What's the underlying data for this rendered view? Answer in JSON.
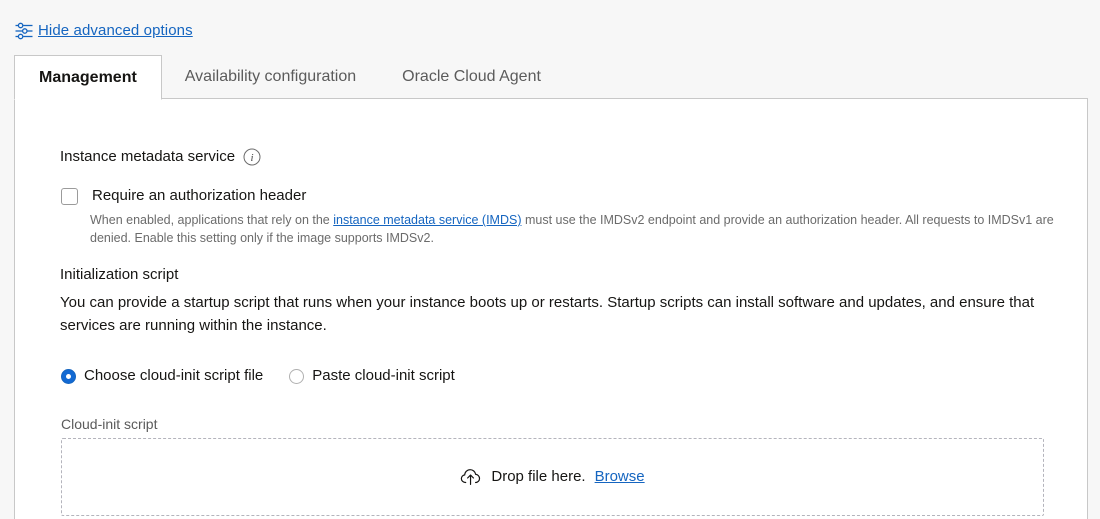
{
  "advanced": {
    "icon": "sliders-icon",
    "link_label": "Hide advanced options"
  },
  "tabs": [
    {
      "label": "Management",
      "active": true
    },
    {
      "label": "Availability configuration",
      "active": false
    },
    {
      "label": "Oracle Cloud Agent",
      "active": false
    }
  ],
  "metadata_section": {
    "heading": "Instance metadata service",
    "info_icon": "info-icon",
    "checkbox": {
      "label": "Require an authorization header",
      "checked": false
    },
    "helper": {
      "before_link": "When enabled, applications that rely on the ",
      "link_text": "instance metadata service (IMDS)",
      "after_link": " must use the IMDSv2 endpoint and provide an authorization header. All requests to IMDSv1 are denied. Enable this setting only if the image supports IMDSv2."
    }
  },
  "init_script_section": {
    "heading": "Initialization script",
    "description": "You can provide a startup script that runs when your instance boots up or restarts. Startup scripts can install software and updates, and ensure that services are running within the instance.",
    "options": [
      {
        "label": "Choose cloud-init script file",
        "selected": true
      },
      {
        "label": "Paste cloud-init script",
        "selected": false
      }
    ]
  },
  "dropzone": {
    "label": "Cloud-init script",
    "icon": "cloud-upload-icon",
    "text": "Drop file here.",
    "browse_label": "Browse"
  },
  "colors": {
    "link": "#1565c0",
    "accent": "#1269d3",
    "page_bg": "#f7f7f7",
    "panel_bg": "#ffffff",
    "border": "#c8c8c8",
    "muted_text": "#6b6b6b"
  }
}
